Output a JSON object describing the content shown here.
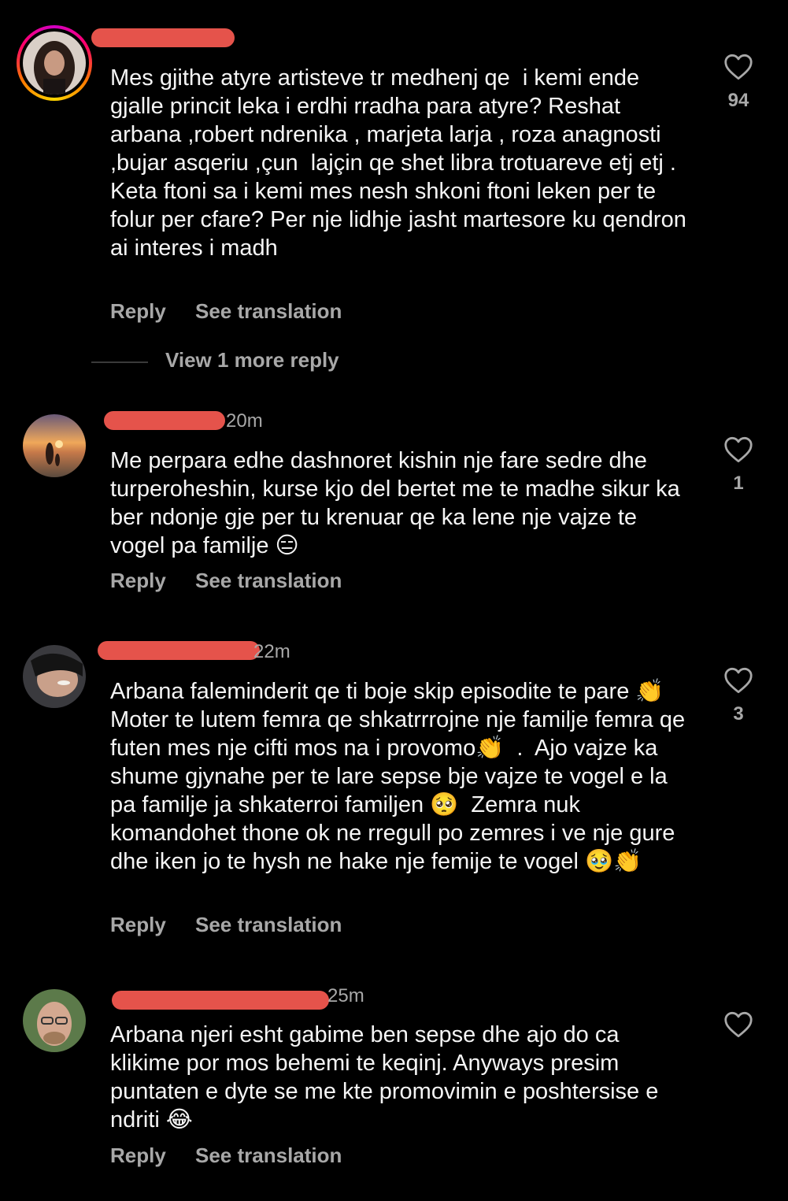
{
  "comments": [
    {
      "time": "",
      "text": "Mes gjithe atyre artisteve tr medhenj qe  i kemi ende gjalle princit leka i erdhi rradha para atyre? Reshat arbana ,robert ndrenika , marjeta larja , roza anagnosti ,bujar asqeriu ,çun  lajçin qe shet libra trotuareve etj etj . Keta ftoni sa i kemi mes nesh shkoni ftoni leken per te folur per cfare? Per nje lidhje jasht martesore ku qendron ai interes i madh",
      "likes": "94",
      "reply_label": "Reply",
      "translate_label": "See translation",
      "view_more": "View 1 more reply"
    },
    {
      "time": "20m",
      "text": "Me perpara edhe dashnoret kishin nje fare sedre dhe turperoheshin, kurse kjo del bertet me te madhe sikur ka ber ndonje gje per tu krenuar qe ka lene nje vajze te vogel pa familje 😑",
      "likes": "1",
      "reply_label": "Reply",
      "translate_label": "See translation"
    },
    {
      "time": "22m",
      "text": "Arbana faleminderit qe ti boje skip episodite te pare 👏 Moter te lutem femra qe shkatrrrojne nje familje femra qe futen mes nje cifti mos na i provomo👏  .  Ajo vajze ka shume gjynahe per te lare sepse bje vajze te vogel e la pa familje ja shkaterroi familjen 🥺  Zemra nuk komandohet thone ok ne rregull po zemres i ve nje gure dhe iken jo te hysh ne hake nje femije te vogel 🥹👏",
      "likes": "3",
      "reply_label": "Reply",
      "translate_label": "See translation"
    },
    {
      "time": "25m",
      "text": "Arbana njeri esht gabime ben sepse dhe ajo do ca klikime por mos behemi te keqinj. Anyways presim puntaten e dyte se me kte promovimin e poshtersise e ndriti 😂",
      "likes": "",
      "reply_label": "Reply",
      "translate_label": "See translation"
    }
  ],
  "colors": {
    "background": "#000000",
    "text": "#f5f5f5",
    "secondary": "#a8a8a8",
    "redaction": "#e5534b"
  },
  "icons": {
    "like": "heart-outline-icon"
  }
}
